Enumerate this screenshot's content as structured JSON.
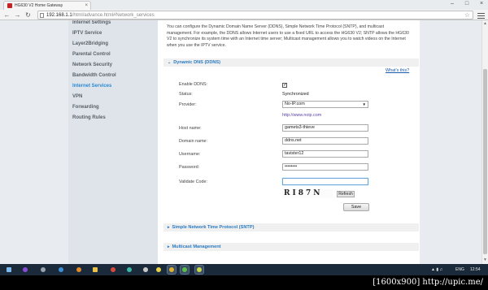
{
  "browser": {
    "tab_title": "HG630 V2 Home Gateway",
    "tab_close": "×",
    "url_host": "192.168.1.1",
    "url_path": "/html/advance.html#Network_services",
    "window_controls": [
      "–",
      "□",
      "×"
    ],
    "icons": {
      "back": "back-arrow-icon",
      "forward": "forward-arrow-icon",
      "reload": "reload-icon",
      "star": "star-icon",
      "menu": "hamburger-menu-icon"
    }
  },
  "sidebar": {
    "items": [
      {
        "label": "Internet Settings",
        "active": false
      },
      {
        "label": "IPTV Service",
        "active": false
      },
      {
        "label": "Layer2Bridging",
        "active": false
      },
      {
        "label": "Parental Control",
        "active": false
      },
      {
        "label": "Network Security",
        "active": false
      },
      {
        "label": "Bandwidth Control",
        "active": false
      },
      {
        "label": "Internet Services",
        "active": true
      },
      {
        "label": "VPN",
        "active": false
      },
      {
        "label": "Forwarding",
        "active": false
      },
      {
        "label": "Routing Rules",
        "active": false
      }
    ]
  },
  "content": {
    "intro": "You can configure the Dynamic Domain Name Server (DDNS), Simple Network Time Protocol (SNTP), and multicast management. For example, the DDNS allows Internet users to use a fixed URL to access the HG630 V2; SNTP allows the HG630 V2 to synchronize its system time with an Internet time server; Multicast management allows you to watch videos on the Internet when you use the IPTV service.",
    "ddns_section": "Dynamic DNS (DDNS)",
    "whats_this": "What's this?",
    "form": {
      "enable_label": "Enable DDNS:",
      "enable_checked": true,
      "status_label": "Status:",
      "status_value": "Synchronized",
      "provider_label": "Provider:",
      "provider_value": "No-IP.com",
      "provider_link": "http://www.noip.com",
      "host_label": "Host name:",
      "host_value": "gamets3-thieve",
      "domain_label": "Domain name:",
      "domain_value": "ddns.net",
      "username_label": "Username:",
      "username_value": "tavister12",
      "password_label": "Password:",
      "password_value": "••••••••",
      "validate_label": "Validate Code:",
      "validate_value": "",
      "captcha_text": "RI87N",
      "refresh_label": "Refresh",
      "save_label": "Save"
    },
    "sntp_section": "Simple Network Time Protocol (SNTP)",
    "multicast_section": "Multicast Management"
  },
  "taskbar": {
    "lang": "ENG",
    "clock": "12:54"
  },
  "watermark": "[1600x900] http://upic.me/"
}
